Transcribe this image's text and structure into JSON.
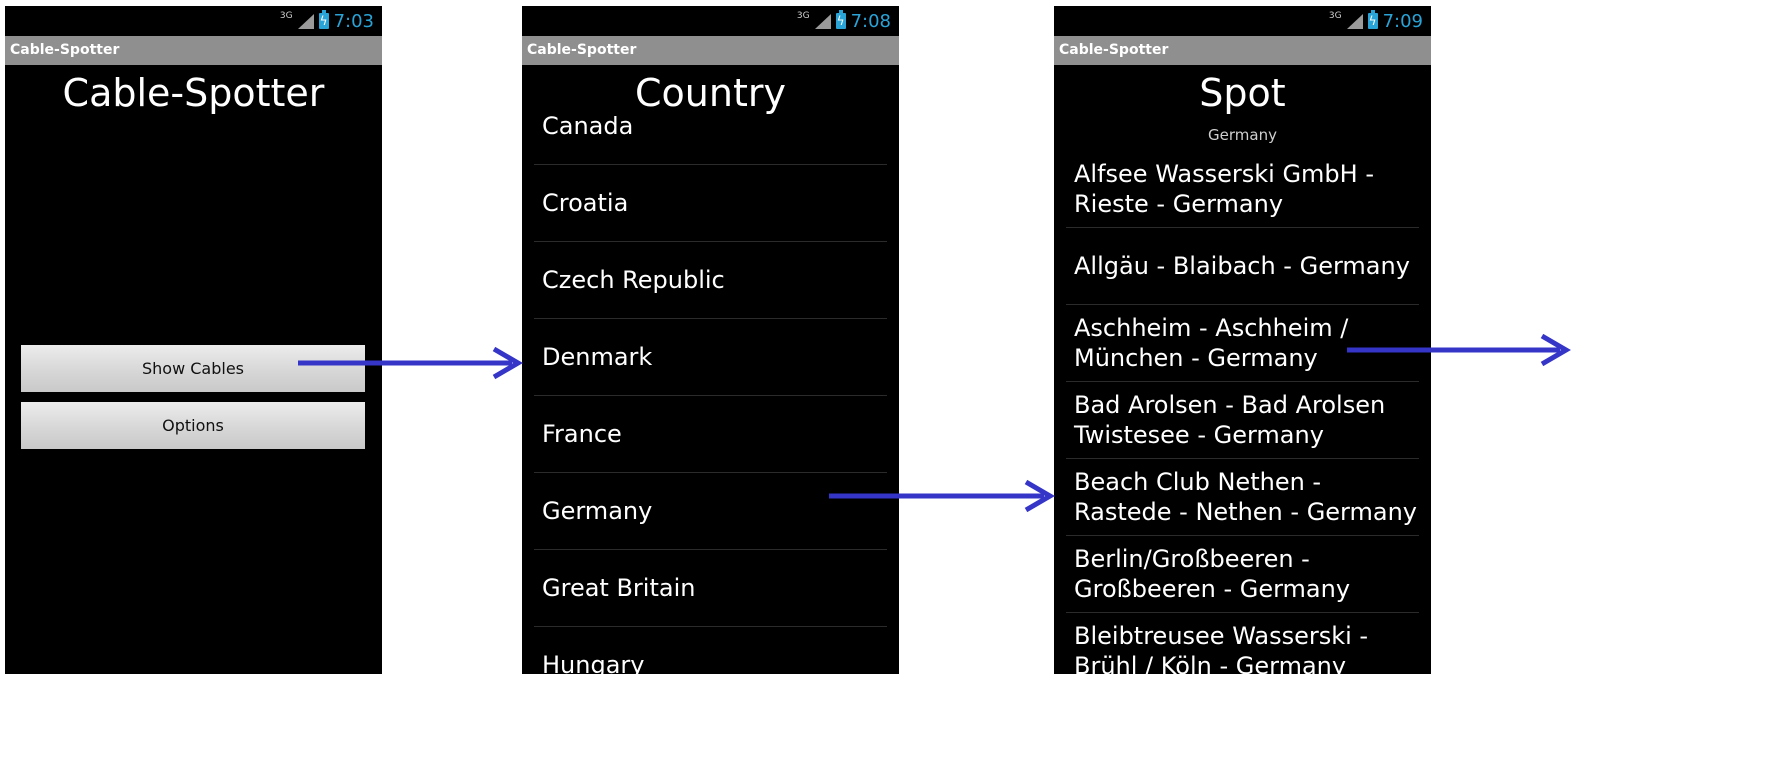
{
  "screens": [
    {
      "status": {
        "network": "3G",
        "time": "7:03"
      },
      "app_title": "Cable-Spotter",
      "title": "Cable-Spotter",
      "buttons": [
        "Show Cables",
        "Options"
      ]
    },
    {
      "status": {
        "network": "3G",
        "time": "7:08"
      },
      "app_title": "Cable-Spotter",
      "title": "Country",
      "items": [
        "Canada",
        "Croatia",
        "Czech Republic",
        "Denmark",
        "France",
        "Germany",
        "Great Britain",
        "Hungary"
      ]
    },
    {
      "status": {
        "network": "3G",
        "time": "7:09"
      },
      "app_title": "Cable-Spotter",
      "title": "Spot",
      "subtitle": "Germany",
      "items": [
        "Alfsee Wasserski GmbH - Rieste - Germany",
        "Allgäu - Blaibach - Germany",
        "Aschheim - Aschheim / München - Germany",
        "Bad Arolsen - Bad Arolsen Twistesee - Germany",
        "Beach Club Nethen - Rastede - Nethen - Germany",
        "Berlin/Großbeeren - Großbeeren - Germany",
        "Bleibtreusee Wasserski - Brühl / Köln - Germany"
      ]
    }
  ],
  "colors": {
    "arrow": "#3535c8",
    "clock": "#2aa3d7",
    "appbar": "#8f8f8f"
  },
  "icons": {
    "signal": "signal-icon",
    "battery": "battery-charging-icon"
  }
}
